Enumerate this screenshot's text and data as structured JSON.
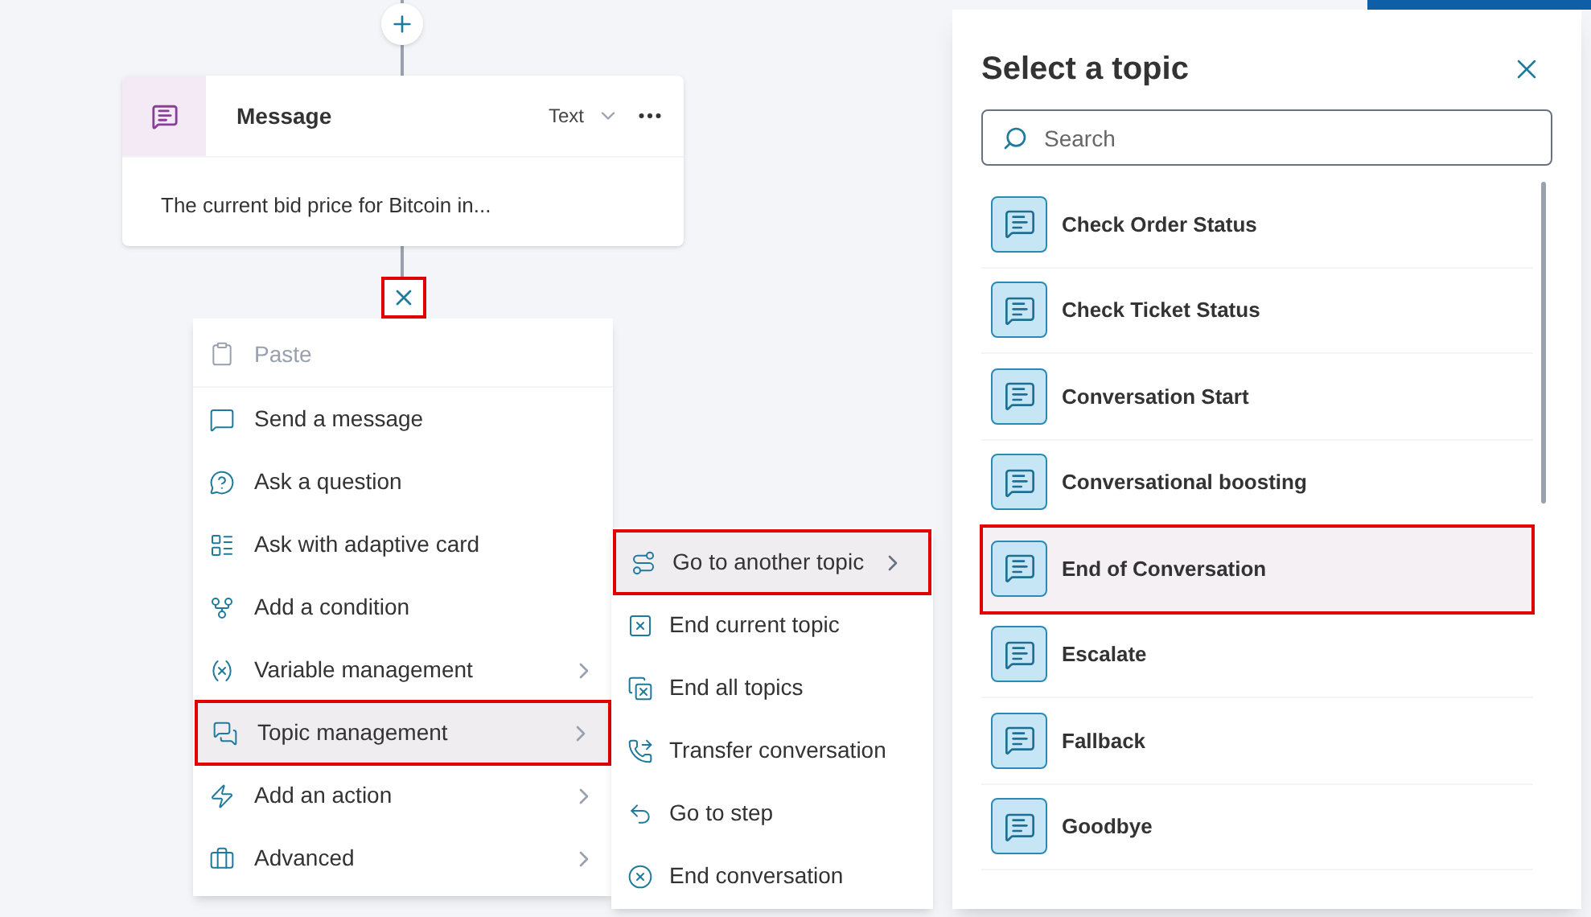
{
  "message_node": {
    "title": "Message",
    "format": "Text",
    "body": "The current bid price for Bitcoin in..."
  },
  "menu": {
    "items": [
      {
        "label": "Paste",
        "kind": "paste",
        "disabled": true,
        "has_submenu": false,
        "selected": false
      },
      {
        "label": "Send a message",
        "kind": "message",
        "disabled": false,
        "has_submenu": false,
        "selected": false
      },
      {
        "label": "Ask a question",
        "kind": "question",
        "disabled": false,
        "has_submenu": false,
        "selected": false
      },
      {
        "label": "Ask with adaptive card",
        "kind": "card",
        "disabled": false,
        "has_submenu": false,
        "selected": false
      },
      {
        "label": "Add a condition",
        "kind": "condition",
        "disabled": false,
        "has_submenu": false,
        "selected": false
      },
      {
        "label": "Variable management",
        "kind": "variable",
        "disabled": false,
        "has_submenu": true,
        "selected": false
      },
      {
        "label": "Topic management",
        "kind": "topic",
        "disabled": false,
        "has_submenu": true,
        "selected": true
      },
      {
        "label": "Add an action",
        "kind": "action",
        "disabled": false,
        "has_submenu": true,
        "selected": false
      },
      {
        "label": "Advanced",
        "kind": "advanced",
        "disabled": false,
        "has_submenu": true,
        "selected": false
      }
    ]
  },
  "submenu": {
    "items": [
      {
        "label": "Go to another topic",
        "kind": "goto",
        "has_submenu": true,
        "selected": true
      },
      {
        "label": "End current topic",
        "kind": "endcurrent",
        "has_submenu": false,
        "selected": false
      },
      {
        "label": "End all topics",
        "kind": "endall",
        "has_submenu": false,
        "selected": false
      },
      {
        "label": "Transfer conversation",
        "kind": "transfer",
        "has_submenu": false,
        "selected": false
      },
      {
        "label": "Go to step",
        "kind": "step",
        "has_submenu": false,
        "selected": false
      },
      {
        "label": "End conversation",
        "kind": "endconv",
        "has_submenu": false,
        "selected": false
      }
    ]
  },
  "topic_panel": {
    "title": "Select a topic",
    "search": {
      "placeholder": "Search"
    },
    "topics": [
      {
        "label": "Check Order Status",
        "selected": false
      },
      {
        "label": "Check Ticket Status",
        "selected": false
      },
      {
        "label": "Conversation Start",
        "selected": false
      },
      {
        "label": "Conversational boosting",
        "selected": false
      },
      {
        "label": "End of Conversation",
        "selected": true
      },
      {
        "label": "Escalate",
        "selected": false
      },
      {
        "label": "Fallback",
        "selected": false
      },
      {
        "label": "Goodbye",
        "selected": false
      }
    ]
  }
}
